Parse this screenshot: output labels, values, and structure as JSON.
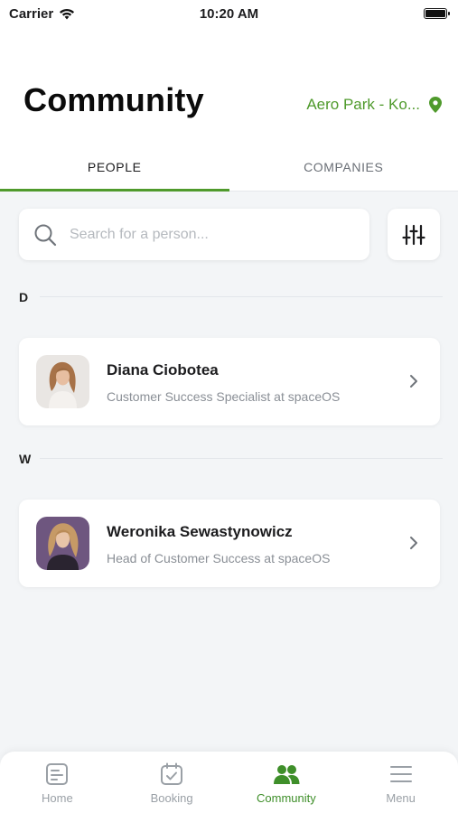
{
  "status_bar": {
    "carrier": "Carrier",
    "time": "10:20 AM"
  },
  "header": {
    "title": "Community",
    "location": "Aero Park - Ko..."
  },
  "tabs": [
    {
      "label": "PEOPLE",
      "active": true
    },
    {
      "label": "COMPANIES",
      "active": false
    }
  ],
  "search": {
    "placeholder": "Search for a person..."
  },
  "sections": [
    {
      "letter": "D",
      "people": [
        {
          "name": "Diana Ciobotea",
          "role": "Customer Success Specialist at spaceOS"
        }
      ]
    },
    {
      "letter": "W",
      "people": [
        {
          "name": "Weronika Sewastynowicz",
          "role": "Head of Customer Success at spaceOS"
        }
      ]
    }
  ],
  "bottom_nav": [
    {
      "label": "Home",
      "icon": "home-document-icon",
      "active": false
    },
    {
      "label": "Booking",
      "icon": "calendar-check-icon",
      "active": false
    },
    {
      "label": "Community",
      "icon": "people-icon",
      "active": true
    },
    {
      "label": "Menu",
      "icon": "menu-icon",
      "active": false
    }
  ],
  "colors": {
    "accent": "#4f9a2c",
    "background": "#f3f5f7"
  }
}
